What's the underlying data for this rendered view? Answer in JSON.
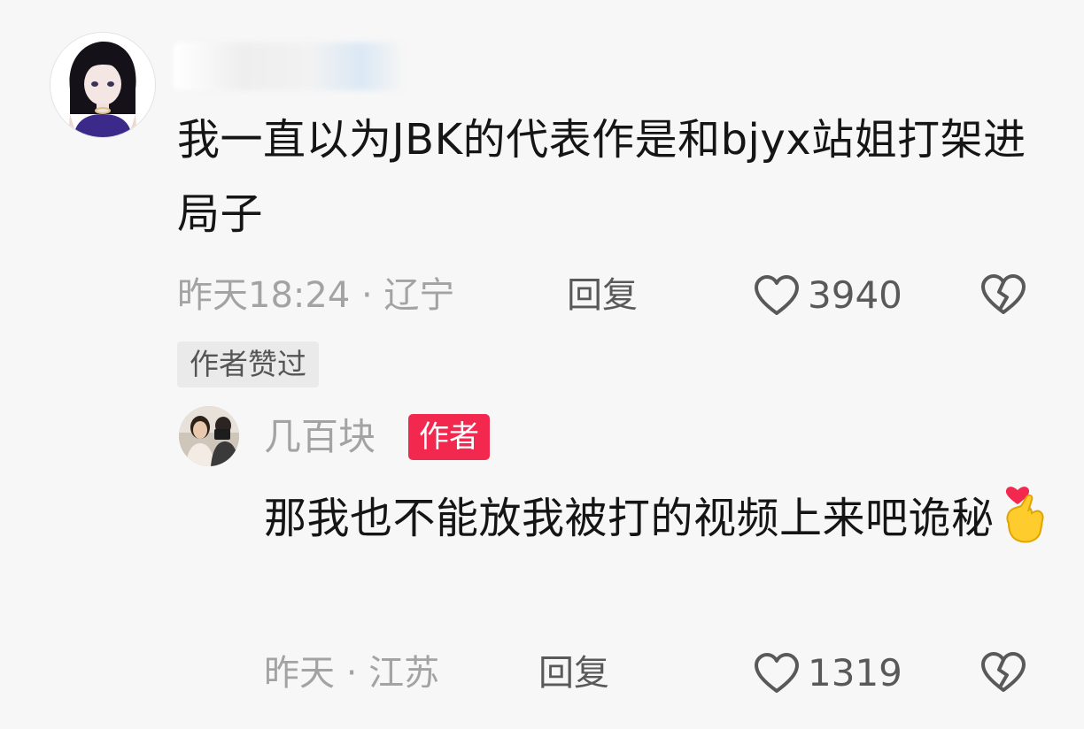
{
  "comment": {
    "text": "我一直以为JBK的代表作是和bjyx站姐打架进局子",
    "time_location": "昨天18:24 · 辽宁",
    "reply_label": "回复",
    "like_count": "3940",
    "liked_badge": "作者赞过",
    "icons": {
      "avatar": "anime-girl-avatar",
      "like": "heart-outline-icon",
      "dislike": "broken-heart-icon"
    }
  },
  "reply": {
    "username": "几百块",
    "author_badge": "作者",
    "text": "那我也不能放我被打的视频上来吧诡秘",
    "time_location": "昨天 · 江苏",
    "reply_label": "回复",
    "like_count": "1319",
    "icons": {
      "avatar": "user-photo-avatar",
      "emoji": "finger-heart-emoji",
      "like": "heart-outline-icon",
      "dislike": "broken-heart-icon"
    }
  },
  "colors": {
    "background": "#f7f7f7",
    "text": "#151515",
    "meta": "#a3a3a3",
    "author_badge": "#f2284f"
  }
}
